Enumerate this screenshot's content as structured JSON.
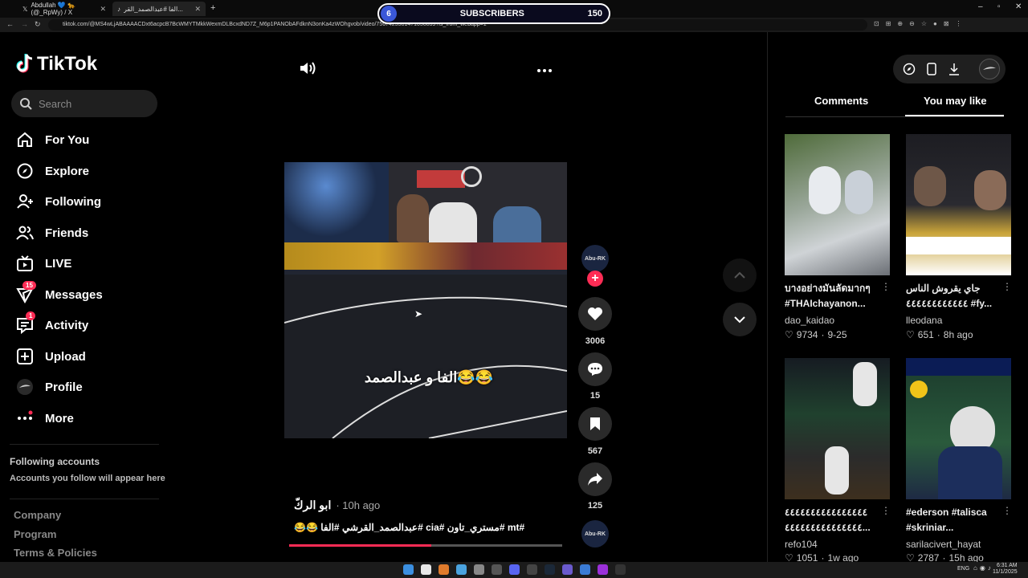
{
  "browser": {
    "tabs": [
      {
        "label": "Abdullah 💙 🐆 (@_RpWy) / X"
      },
      {
        "label": "الفا #عبدالصمد_القر..."
      }
    ],
    "url": "tiktok.com/@MS4wLjABAAAACDxt6acpcB7BcWMYTMkkWexmDLBcxdND7Z_M6p1PANObAFdknN3onKa4zWOhgvob/video/7567425581471050839?is_from_webapp=1"
  },
  "overlay": {
    "count": "6",
    "label": "SUBSCRIBERS",
    "value": "150"
  },
  "sidebar": {
    "logo": "TikTok",
    "search_placeholder": "Search",
    "items": [
      {
        "label": "For You",
        "icon": "home-icon"
      },
      {
        "label": "Explore",
        "icon": "compass-icon"
      },
      {
        "label": "Following",
        "icon": "following-icon"
      },
      {
        "label": "Friends",
        "icon": "friends-icon"
      },
      {
        "label": "LIVE",
        "icon": "live-icon"
      },
      {
        "label": "Messages",
        "icon": "messages-icon",
        "badge": "15"
      },
      {
        "label": "Activity",
        "icon": "activity-icon",
        "badge": "1"
      },
      {
        "label": "Upload",
        "icon": "upload-icon"
      },
      {
        "label": "Profile",
        "icon": "avatar"
      },
      {
        "label": "More",
        "icon": "more-icon"
      }
    ],
    "following_title": "Following accounts",
    "following_sub": "Accounts you follow will appear here",
    "footer": [
      "Company",
      "Program",
      "Terms & Policies"
    ]
  },
  "video": {
    "caption_overlay": "الفا و عبدالصمد😂😂",
    "author": "ابو الركّ",
    "time": "· 10h ago",
    "description": "#mt #مستري_تاون #cia #عبدالصمد_القرشي #الفا 😂😂",
    "progress": 0.52,
    "actions": {
      "author_tag": "Abu-RK",
      "likes": "3006",
      "comments": "15",
      "saves": "567",
      "shares": "125",
      "next_author_tag": "Abu-RK"
    }
  },
  "panel": {
    "tabs": [
      "Comments",
      "You may like"
    ],
    "active_tab": "You may like",
    "cards": [
      {
        "title": "บางอย่างมันลัดมากๆ #THAIchayanon...",
        "user": "dao_kaidao",
        "likes": "9734",
        "date": "9-25"
      },
      {
        "title": "جاي يقروش الناس ٤٤٤٤٤٤٤٤٤٤٤٤ #fy...",
        "user": "lleodana",
        "likes": "651",
        "date": "8h ago"
      },
      {
        "title": "٤٤٤٤٤٤٤٤٤٤٤٤٤٤٤٤ ٤٤٤٤٤٤٤٤٤٤٤٤٤٤٤...",
        "user": "refo104",
        "likes": "1051",
        "date": "1w ago"
      },
      {
        "title": "#ederson #talisca #skriniar...",
        "user": "sarilacivert_hayat",
        "likes": "2787",
        "date": "15h ago"
      }
    ]
  },
  "taskbar": {
    "lang": "ENG",
    "time": "6:31 AM",
    "date": "11/1/2025"
  }
}
